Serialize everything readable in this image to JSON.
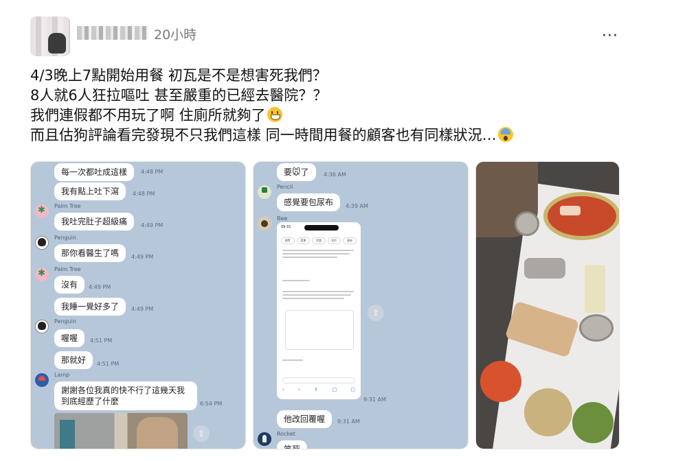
{
  "post": {
    "timestamp": "20小時",
    "more_label": "···",
    "lines": [
      "4/3晚上7點開始用餐 初瓦是不是想害死我們？",
      "8人就6人狂拉嘔吐 甚至嚴重的已經去醫院？？",
      "我們連假都不用玩了啊 住廁所就夠了",
      "而且估狗評論看完發現不只我們這樣 同一時間用餐的顧客也有同樣狀況…"
    ]
  },
  "chat1": {
    "messages": [
      {
        "text": "每一次都吐成這樣",
        "time": "4:48 PM"
      },
      {
        "text": "我有點上吐下瀉",
        "time": "4:48 PM"
      },
      {
        "sender": "Palm Tree",
        "text": "我吐完肚子超級痛",
        "time": "4:49 PM"
      },
      {
        "sender": "Penguin",
        "text": "那你看醫生了嗎",
        "time": "4:49 PM"
      },
      {
        "sender": "Palm Tree",
        "text": "沒有",
        "time": "4:49 PM"
      },
      {
        "text": "我睡一覺好多了",
        "time": "4:49 PM"
      },
      {
        "sender": "Penguin",
        "text": "喔喔",
        "time": "4:51 PM"
      },
      {
        "text": "那就好",
        "time": "4:51 PM"
      },
      {
        "sender": "Lamp",
        "text_line1": "謝謝各位我真的快不行了這幾天我",
        "text_line2": "到底經歷了什麼",
        "time": "6:54 PM"
      }
    ]
  },
  "chat2": {
    "messages": [
      {
        "text": "要🐭了",
        "time": "4:36 AM"
      },
      {
        "sender": "Pencil",
        "text": "感覺要包尿布",
        "time": "4:39 AM"
      },
      {
        "sender": "Bee",
        "time": "9:31 AM"
      },
      {
        "text": "他改回覆喔",
        "time": "9:31 AM"
      },
      {
        "sender": "Rocket",
        "text": "笑死"
      }
    ],
    "phone": {
      "clock": "09:31",
      "tabs": [
        "總覽",
        "菜單",
        "評論",
        "相片",
        "更新"
      ]
    }
  }
}
